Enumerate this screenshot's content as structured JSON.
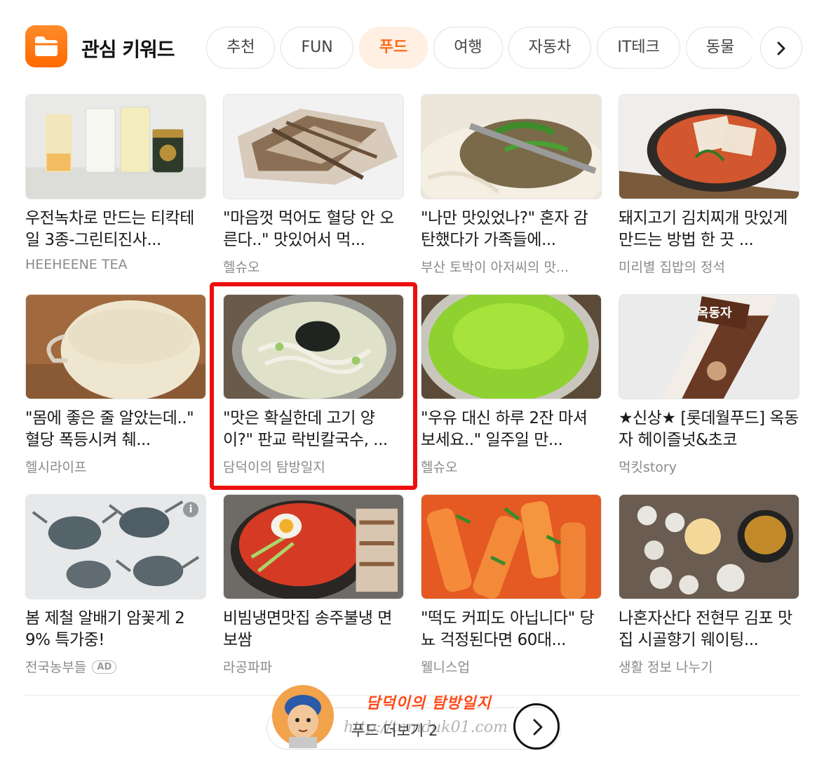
{
  "header": {
    "title": "관심 키워드",
    "icon": "folder-icon",
    "accent_color": "#ff6a00"
  },
  "tabs": [
    {
      "label": "추천",
      "active": false
    },
    {
      "label": "FUN",
      "active": false
    },
    {
      "label": "푸드",
      "active": true
    },
    {
      "label": "여행",
      "active": false
    },
    {
      "label": "자동차",
      "active": false
    },
    {
      "label": "IT테크",
      "active": false
    },
    {
      "label": "동물",
      "active": false
    }
  ],
  "cards": [
    {
      "title": "우전녹차로 만드는 티칵테일 3종-그린티진사...",
      "source": "HEEHEENE TEA"
    },
    {
      "title": "\"마음껏 먹어도 혈당 안 오른다..\" 맛있어서 먹...",
      "source": "헬슈오"
    },
    {
      "title": "\"나만 맛있었나?\" 혼자 감탄했다가 가족들에...",
      "source": "부산 토박이 아저씨의 맛..."
    },
    {
      "title": "돼지고기 김치찌개 맛있게 만드는 방법 한 끗 ...",
      "source": "미리별 집밥의 정석"
    },
    {
      "title": "\"몸에 좋은 줄 알았는데..\" 혈당 폭등시켜 췌...",
      "source": "헬시라이프"
    },
    {
      "title": "\"맛은 확실한데 고기 양이?\" 판교 락빈칼국수, ...",
      "source": "담덕이의 탐방일지"
    },
    {
      "title": "\"우유 대신 하루 2잔 마셔보세요..\" 일주일 만...",
      "source": "헬슈오"
    },
    {
      "title": "★신상★ [롯데월푸드] 옥동자 헤이즐넛&초코",
      "source": "먹킷story"
    },
    {
      "title": "봄 제철 알배기 암꽃게 29% 특가중!",
      "source": "전국농부들",
      "ad": "AD"
    },
    {
      "title": "비빔냉면맛집 송주불냉 면보쌈",
      "source": "라공파파"
    },
    {
      "title": "\"떡도 커피도 아닙니다\" 당뇨 걱정된다면 60대...",
      "source": "웰니스업"
    },
    {
      "title": "나혼자산다 전현무 김포 맛집 시골향기 웨이팅...",
      "source": "생활 정보 나누기"
    }
  ],
  "thumb_labels": {
    "ice_pop": "옥동자"
  },
  "footer": {
    "more_label": "푸드 더보기 2"
  },
  "watermark": {
    "title": "담덕이의 탐방일지",
    "url": "http://tamduk01.com"
  },
  "colors": {
    "active_tab_bg": "#fff0e3",
    "active_tab_text": "#ff6a1a",
    "highlight": "#ee0f0f"
  }
}
